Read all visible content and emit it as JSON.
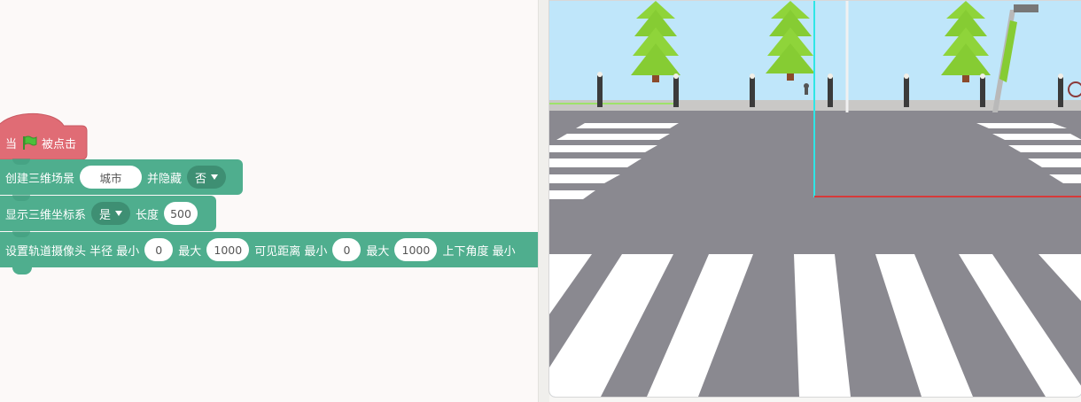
{
  "workspace": {
    "hat_block": {
      "prefix": "当",
      "flag_icon": "green-flag-icon",
      "suffix": "被点击"
    },
    "block_create_scene": {
      "label": "创建三维场景",
      "scene_value": "城市",
      "hide_label": "并隐藏",
      "hide_value": "否"
    },
    "block_show_axes": {
      "label": "显示三维坐标系",
      "show_value": "是",
      "length_label": "长度",
      "length_value": "500"
    },
    "block_orbit_camera": {
      "label": "设置轨道摄像头 半径 最小",
      "radius_min": "0",
      "max_label": "最大",
      "radius_max": "1000",
      "visible_label": "可见距离 最小",
      "visible_min": "0",
      "max_label_2": "最大",
      "visible_max": "1000",
      "angle_label": "上下角度 最小"
    },
    "colors": {
      "hat_block": "#e06c75",
      "command_block": "#4fae8e"
    }
  },
  "stage": {
    "scene": "city-crosswalk-3d",
    "colors": {
      "sky": "#bfe6fa",
      "road": "#8a8990",
      "stripe": "#ffffff",
      "tree": "#8fd43a",
      "axis_x": "#d63a3a",
      "axis_y": "#2ee6e6"
    }
  }
}
